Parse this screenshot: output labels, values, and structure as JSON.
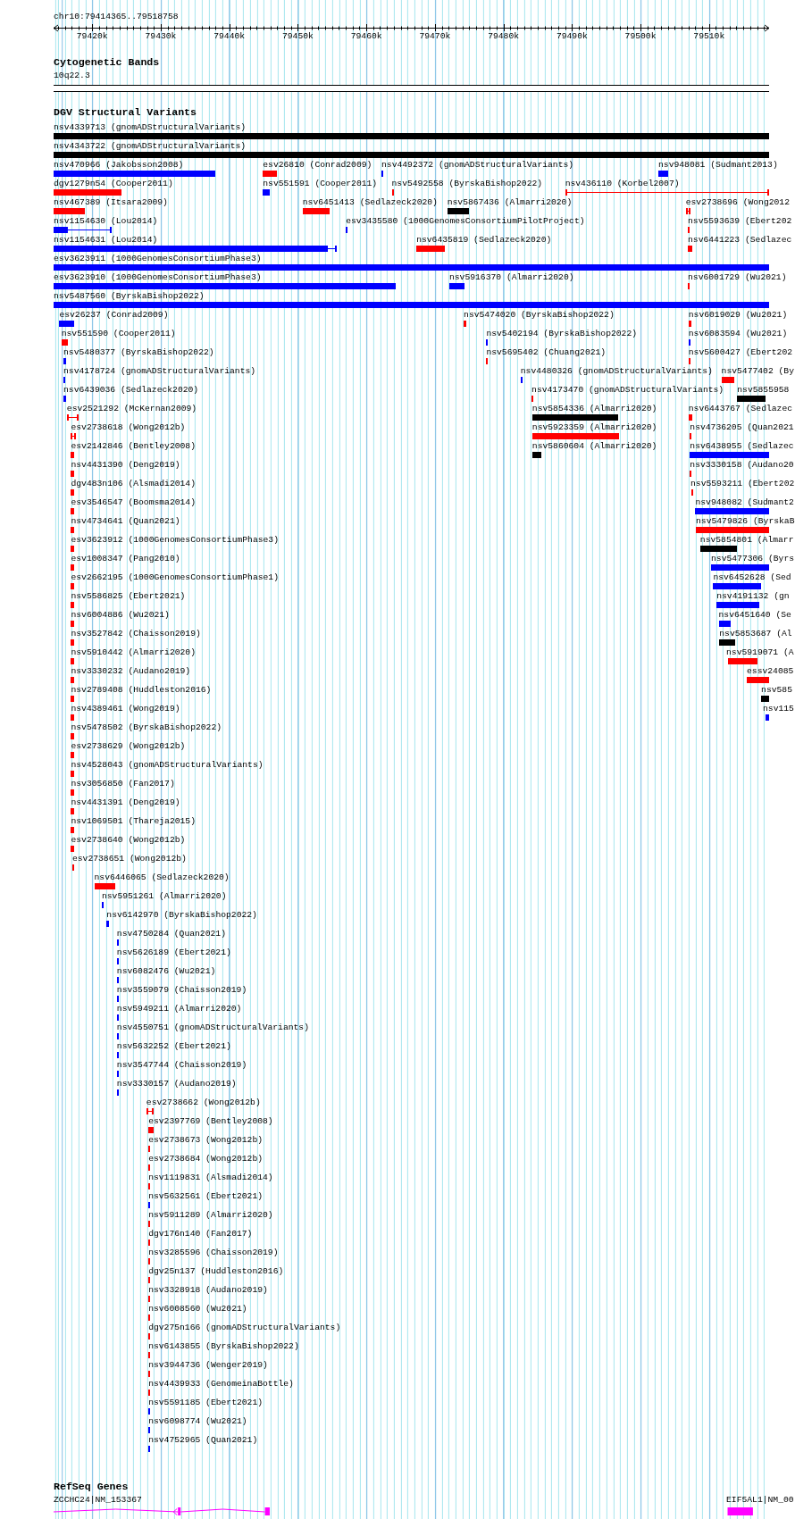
{
  "ruler": {
    "label": "chr10:79414365..79518758",
    "ticks": [
      {
        "label": "79420k"
      },
      {
        "label": "79430k"
      },
      {
        "label": "79440k"
      },
      {
        "label": "79450k"
      },
      {
        "label": "79460k"
      },
      {
        "label": "79470k"
      },
      {
        "label": "79480k"
      },
      {
        "label": "79490k"
      },
      {
        "label": "79500k"
      },
      {
        "label": "79510k"
      }
    ]
  },
  "tracks": [
    {
      "kind": "bands",
      "title": "Cytogenetic Bands",
      "bands": [
        {
          "name": "10q22.3"
        }
      ]
    },
    {
      "kind": "variants",
      "title": "DGV Structural Variants",
      "rows": [
        {
          "features": [
            {
              "label": "nsv4339713 (gnomADStructuralVariants)",
              "kind": "bar",
              "color": "#000000"
            }
          ]
        },
        {
          "features": [
            {
              "label": "nsv4343722 (gnomADStructuralVariants)",
              "kind": "bar",
              "color": "#000000"
            }
          ]
        },
        {
          "features": [
            {
              "label": "nsv470966 (Jakobsson2008)",
              "kind": "bar",
              "color": "#0000ff"
            },
            {
              "label": "esv26810 (Conrad2009)",
              "kind": "bar",
              "color": "#ff0000"
            },
            {
              "label": "nsv4492372 (gnomADStructuralVariants)",
              "kind": "bar",
              "color": "#0000ff"
            },
            {
              "label": "nsv948081 (Sudmant2013)",
              "kind": "bar",
              "color": "#0000ff"
            }
          ]
        },
        {
          "features": [
            {
              "label": "dgv1279n54 (Cooper2011)",
              "kind": "bar",
              "color": "#ff0000"
            },
            {
              "label": "nsv551591 (Cooper2011)",
              "kind": "bar",
              "color": "#0000ff"
            },
            {
              "label": "nsv5492558 (ByrskaBishop2022)",
              "kind": "bar",
              "color": "#ff0000"
            },
            {
              "label": "nsv436110 (Korbel2007)",
              "kind": "line",
              "color": "#ff0000"
            }
          ]
        },
        {
          "features": [
            {
              "label": "nsv467389 (Itsara2009)",
              "kind": "bar",
              "color": "#ff0000"
            },
            {
              "label": "nsv6451413 (Sedlazeck2020)",
              "kind": "bar",
              "color": "#ff0000"
            },
            {
              "label": "nsv5867436 (Almarri2020)",
              "kind": "bar",
              "color": "#000000"
            },
            {
              "label": "esv2738696 (Wong2012",
              "kind": "line",
              "color": "#ff0000"
            }
          ]
        },
        {
          "features": [
            {
              "label": "nsv1154630 (Lou2014)",
              "kind": "whisker",
              "color": "#0000ff"
            },
            {
              "label": "esv3435580 (1000GenomesConsortiumPilotProject)",
              "kind": "bar",
              "color": "#0000ff"
            },
            {
              "label": "nsv5593639 (Ebert202",
              "kind": "bar",
              "color": "#ff0000"
            }
          ]
        },
        {
          "features": [
            {
              "label": "nsv1154631 (Lou2014)",
              "kind": "whisker",
              "color": "#0000ff"
            },
            {
              "label": "nsv6435819 (Sedlazeck2020)",
              "kind": "bar",
              "color": "#ff0000"
            },
            {
              "label": "nsv6441223 (Sedlazec",
              "kind": "bar",
              "color": "#ff0000"
            }
          ]
        },
        {
          "features": [
            {
              "label": "esv3623911 (1000GenomesConsortiumPhase3)",
              "kind": "bar",
              "color": "#0000ff"
            }
          ]
        },
        {
          "features": [
            {
              "label": "esv3623910 (1000GenomesConsortiumPhase3)",
              "kind": "bar",
              "color": "#0000ff"
            },
            {
              "label": "nsv5916370 (Almarri2020)",
              "kind": "bar",
              "color": "#0000ff"
            },
            {
              "label": "nsv6001729 (Wu2021)",
              "kind": "bar",
              "color": "#ff0000"
            }
          ]
        },
        {
          "features": [
            {
              "label": "nsv5487560 (ByrskaBishop2022)",
              "kind": "bar",
              "color": "#0000ff"
            }
          ]
        },
        {
          "features": [
            {
              "label": "esv26237 (Conrad2009)",
              "kind": "bar",
              "color": "#0000ff"
            },
            {
              "label": "nsv5474020 (ByrskaBishop2022)",
              "kind": "bar",
              "color": "#ff0000"
            },
            {
              "label": "nsv6019029 (Wu2021)",
              "kind": "bar",
              "color": "#ff0000"
            }
          ]
        },
        {
          "features": [
            {
              "label": "nsv551590 (Cooper2011)",
              "kind": "bar",
              "color": "#ff0000"
            },
            {
              "label": "nsv5402194 (ByrskaBishop2022)",
              "kind": "bar",
              "color": "#0000ff"
            },
            {
              "label": "nsv6083594 (Wu2021)",
              "kind": "bar",
              "color": "#0000ff"
            }
          ]
        },
        {
          "features": [
            {
              "label": "nsv5480377 (ByrskaBishop2022)",
              "kind": "bar",
              "color": "#0000ff"
            },
            {
              "label": "nsv5695402 (Chuang2021)",
              "kind": "bar",
              "color": "#ff0000"
            },
            {
              "label": "nsv5600427 (Ebert202",
              "kind": "bar",
              "color": "#ff0000"
            }
          ]
        },
        {
          "features": [
            {
              "label": "nsv4178724 (gnomADStructuralVariants)",
              "kind": "bar",
              "color": "#0000ff"
            },
            {
              "label": "nsv4480326 (gnomADStructuralVariants)",
              "kind": "bar",
              "color": "#0000ff"
            },
            {
              "label": "nsv5477402 (By",
              "kind": "bar",
              "color": "#ff0000"
            }
          ]
        },
        {
          "features": [
            {
              "label": "nsv6439036 (Sedlazeck2020)",
              "kind": "bar",
              "color": "#0000ff"
            },
            {
              "label": "nsv4173470 (gnomADStructuralVariants)",
              "kind": "bar",
              "color": "#ff0000"
            },
            {
              "label": "nsv5855958",
              "kind": "bar",
              "color": "#000000"
            }
          ]
        },
        {
          "features": [
            {
              "label": "esv2521292 (McKernan2009)",
              "kind": "line",
              "color": "#ff0000"
            },
            {
              "label": "nsv5854336 (Almarri2020)",
              "kind": "bar",
              "color": "#000000"
            },
            {
              "label": "nsv6443767 (Sedlazec",
              "kind": "bar",
              "color": "#ff0000"
            }
          ]
        },
        {
          "features": [
            {
              "label": "esv2738618 (Wong2012b)",
              "kind": "line",
              "color": "#ff0000"
            },
            {
              "label": "nsv5923359 (Almarri2020)",
              "kind": "bar",
              "color": "#ff0000"
            },
            {
              "label": "nsv4736205 (Quan2021",
              "kind": "bar",
              "color": "#ff0000"
            }
          ]
        },
        {
          "features": [
            {
              "label": "esv2142846 (Bentley2008)",
              "kind": "bar",
              "color": "#ff0000"
            },
            {
              "label": "nsv5860604 (Almarri2020)",
              "kind": "bar",
              "color": "#000000"
            },
            {
              "label": "nsv6438955 (Sedlazec",
              "kind": "bar",
              "color": "#0000ff"
            }
          ]
        },
        {
          "features": [
            {
              "label": "nsv4431390 (Deng2019)",
              "kind": "bar",
              "color": "#ff0000"
            },
            {
              "label": "nsv3330158 (Audano20",
              "kind": "bar",
              "color": "#ff0000"
            }
          ]
        },
        {
          "features": [
            {
              "label": "dgv483n106 (Alsmadi2014)",
              "kind": "bar",
              "color": "#ff0000"
            },
            {
              "label": "nsv5593211 (Ebert202",
              "kind": "bar",
              "color": "#ff0000"
            }
          ]
        },
        {
          "features": [
            {
              "label": "esv3546547 (Boomsma2014)",
              "kind": "bar",
              "color": "#ff0000"
            },
            {
              "label": "nsv948082 (Sudmant2",
              "kind": "bar",
              "color": "#0000ff"
            }
          ]
        },
        {
          "features": [
            {
              "label": "nsv4734641 (Quan2021)",
              "kind": "bar",
              "color": "#ff0000"
            },
            {
              "label": "nsv5479826 (ByrskaB",
              "kind": "bar",
              "color": "#ff0000"
            }
          ]
        },
        {
          "features": [
            {
              "label": "esv3623912 (1000GenomesConsortiumPhase3)",
              "kind": "bar",
              "color": "#ff0000"
            },
            {
              "label": "nsv5854801 (Almarr",
              "kind": "bar",
              "color": "#000000"
            }
          ]
        },
        {
          "features": [
            {
              "label": "esv1008347 (Pang2010)",
              "kind": "bar",
              "color": "#ff0000"
            },
            {
              "label": "nsv5477306 (Byrs",
              "kind": "bar",
              "color": "#0000ff"
            }
          ]
        },
        {
          "features": [
            {
              "label": "esv2662195 (1000GenomesConsortiumPhase1)",
              "kind": "bar",
              "color": "#ff0000"
            },
            {
              "label": "nsv6452628 (Sed",
              "kind": "bar",
              "color": "#0000ff"
            }
          ]
        },
        {
          "features": [
            {
              "label": "nsv5586825 (Ebert2021)",
              "kind": "bar",
              "color": "#ff0000"
            },
            {
              "label": "nsv4191132 (gn",
              "kind": "bar",
              "color": "#0000ff"
            }
          ]
        },
        {
          "features": [
            {
              "label": "nsv6004886 (Wu2021)",
              "kind": "bar",
              "color": "#ff0000"
            },
            {
              "label": "nsv6451640 (Se",
              "kind": "bar",
              "color": "#0000ff"
            }
          ]
        },
        {
          "features": [
            {
              "label": "nsv3527842 (Chaisson2019)",
              "kind": "bar",
              "color": "#ff0000"
            },
            {
              "label": "nsv5853687 (Al",
              "kind": "bar",
              "color": "#000000"
            }
          ]
        },
        {
          "features": [
            {
              "label": "nsv5910442 (Almarri2020)",
              "kind": "bar",
              "color": "#ff0000"
            },
            {
              "label": "nsv5919071 (A",
              "kind": "bar",
              "color": "#ff0000"
            }
          ]
        },
        {
          "features": [
            {
              "label": "nsv3330232 (Audano2019)",
              "kind": "bar",
              "color": "#ff0000"
            },
            {
              "label": "essv24085",
              "kind": "bar",
              "color": "#ff0000"
            }
          ]
        },
        {
          "features": [
            {
              "label": "nsv2789408 (Huddleston2016)",
              "kind": "bar",
              "color": "#ff0000"
            },
            {
              "label": "nsv585",
              "kind": "bar",
              "color": "#000000"
            }
          ]
        },
        {
          "features": [
            {
              "label": "nsv4389461 (Wong2019)",
              "kind": "bar",
              "color": "#ff0000"
            },
            {
              "label": "nsv115",
              "kind": "bar",
              "color": "#0000ff"
            }
          ]
        },
        {
          "features": [
            {
              "label": "nsv5478502 (ByrskaBishop2022)",
              "kind": "bar",
              "color": "#ff0000"
            }
          ]
        },
        {
          "features": [
            {
              "label": "esv2738629 (Wong2012b)",
              "kind": "bar",
              "color": "#ff0000"
            }
          ]
        },
        {
          "features": [
            {
              "label": "nsv4528043 (gnomADStructuralVariants)",
              "kind": "bar",
              "color": "#ff0000"
            }
          ]
        },
        {
          "features": [
            {
              "label": "nsv3056850 (Fan2017)",
              "kind": "bar",
              "color": "#ff0000"
            }
          ]
        },
        {
          "features": [
            {
              "label": "nsv4431391 (Deng2019)",
              "kind": "bar",
              "color": "#ff0000"
            }
          ]
        },
        {
          "features": [
            {
              "label": "nsv1069501 (Thareja2015)",
              "kind": "bar",
              "color": "#ff0000"
            }
          ]
        },
        {
          "features": [
            {
              "label": "esv2738640 (Wong2012b)",
              "kind": "bar",
              "color": "#ff0000"
            }
          ]
        },
        {
          "features": [
            {
              "label": "esv2738651 (Wong2012b)",
              "kind": "bar",
              "color": "#ff0000"
            }
          ]
        },
        {
          "features": [
            {
              "label": "nsv6446065 (Sedlazeck2020)",
              "kind": "bar",
              "color": "#ff0000"
            }
          ]
        },
        {
          "features": [
            {
              "label": "nsv5951261 (Almarri2020)",
              "kind": "bar",
              "color": "#0000ff"
            }
          ]
        },
        {
          "features": [
            {
              "label": "nsv6142970 (ByrskaBishop2022)",
              "kind": "bar",
              "color": "#0000ff"
            }
          ]
        },
        {
          "features": [
            {
              "label": "nsv4750284 (Quan2021)",
              "kind": "bar",
              "color": "#0000ff"
            }
          ]
        },
        {
          "features": [
            {
              "label": "nsv5626189 (Ebert2021)",
              "kind": "bar",
              "color": "#0000ff"
            }
          ]
        },
        {
          "features": [
            {
              "label": "nsv6082476 (Wu2021)",
              "kind": "bar",
              "color": "#0000ff"
            }
          ]
        },
        {
          "features": [
            {
              "label": "nsv3559079 (Chaisson2019)",
              "kind": "bar",
              "color": "#0000ff"
            }
          ]
        },
        {
          "features": [
            {
              "label": "nsv5949211 (Almarri2020)",
              "kind": "bar",
              "color": "#0000ff"
            }
          ]
        },
        {
          "features": [
            {
              "label": "nsv4550751 (gnomADStructuralVariants)",
              "kind": "bar",
              "color": "#0000ff"
            }
          ]
        },
        {
          "features": [
            {
              "label": "nsv5632252 (Ebert2021)",
              "kind": "bar",
              "color": "#0000ff"
            }
          ]
        },
        {
          "features": [
            {
              "label": "nsv3547744 (Chaisson2019)",
              "kind": "bar",
              "color": "#0000ff"
            }
          ]
        },
        {
          "features": [
            {
              "label": "nsv3330157 (Audano2019)",
              "kind": "bar",
              "color": "#0000ff"
            }
          ]
        },
        {
          "features": [
            {
              "label": "esv2738662 (Wong2012b)",
              "kind": "line",
              "color": "#ff0000"
            }
          ]
        },
        {
          "features": [
            {
              "label": "esv2397769 (Bentley2008)",
              "kind": "bar",
              "color": "#ff0000"
            }
          ]
        },
        {
          "features": [
            {
              "label": "esv2738673 (Wong2012b)",
              "kind": "bar",
              "color": "#ff0000"
            }
          ]
        },
        {
          "features": [
            {
              "label": "esv2738684 (Wong2012b)",
              "kind": "bar",
              "color": "#ff0000"
            }
          ]
        },
        {
          "features": [
            {
              "label": "nsv1119831 (Alsmadi2014)",
              "kind": "bar",
              "color": "#ff0000"
            }
          ]
        },
        {
          "features": [
            {
              "label": "nsv5632561 (Ebert2021)",
              "kind": "bar",
              "color": "#0000ff"
            }
          ]
        },
        {
          "features": [
            {
              "label": "nsv5911289 (Almarri2020)",
              "kind": "bar",
              "color": "#ff0000"
            }
          ]
        },
        {
          "features": [
            {
              "label": "dgv176n140 (Fan2017)",
              "kind": "bar",
              "color": "#ff0000"
            }
          ]
        },
        {
          "features": [
            {
              "label": "nsv3285596 (Chaisson2019)",
              "kind": "bar",
              "color": "#ff0000"
            }
          ]
        },
        {
          "features": [
            {
              "label": "dgv25n137 (Huddleston2016)",
              "kind": "bar",
              "color": "#ff0000"
            }
          ]
        },
        {
          "features": [
            {
              "label": "nsv3328918 (Audano2019)",
              "kind": "bar",
              "color": "#ff0000"
            }
          ]
        },
        {
          "features": [
            {
              "label": "nsv6008560 (Wu2021)",
              "kind": "bar",
              "color": "#ff0000"
            }
          ]
        },
        {
          "features": [
            {
              "label": "dgv275n166 (gnomADStructuralVariants)",
              "kind": "bar",
              "color": "#ff0000"
            }
          ]
        },
        {
          "features": [
            {
              "label": "nsv6143855 (ByrskaBishop2022)",
              "kind": "bar",
              "color": "#ff0000"
            }
          ]
        },
        {
          "features": [
            {
              "label": "nsv3944736 (Wenger2019)",
              "kind": "bar",
              "color": "#ff0000"
            }
          ]
        },
        {
          "features": [
            {
              "label": "nsv4439933 (GenomeinaBottle)",
              "kind": "bar",
              "color": "#ff0000"
            }
          ]
        },
        {
          "features": [
            {
              "label": "nsv5591185 (Ebert2021)",
              "kind": "bar",
              "color": "#0000ff"
            }
          ]
        },
        {
          "features": [
            {
              "label": "nsv6098774 (Wu2021)",
              "kind": "bar",
              "color": "#0000ff"
            }
          ]
        },
        {
          "features": [
            {
              "label": "nsv4752965 (Quan2021)",
              "kind": "bar",
              "color": "#0000ff"
            }
          ]
        }
      ]
    },
    {
      "kind": "genes",
      "title": "RefSeq Genes",
      "genes": [
        {
          "label": "ZCCHC24|NM_153367",
          "reverse_strand": true
        },
        {
          "label": "EIF5AL1|NM_00",
          "reverse_strand": false
        }
      ]
    }
  ]
}
